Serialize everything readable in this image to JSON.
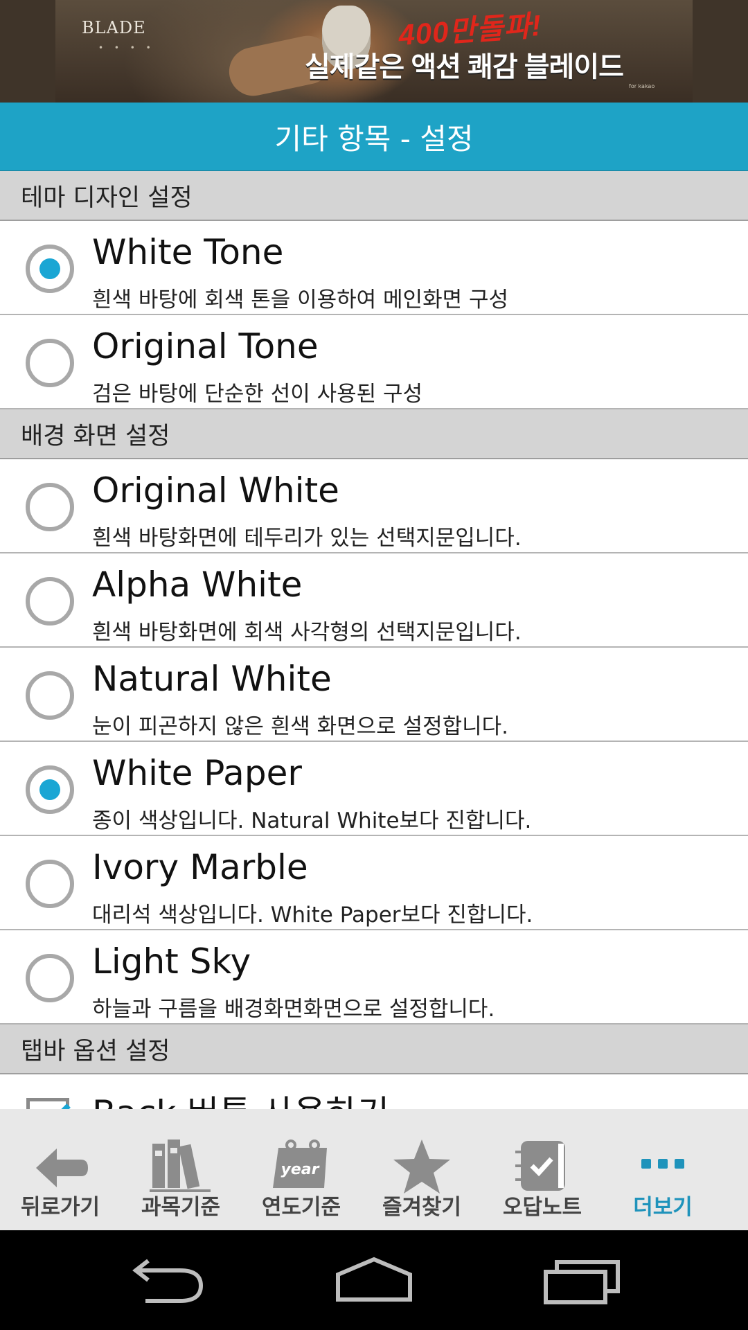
{
  "ad": {
    "logo": "BLADE",
    "logo_dots": "• • • •",
    "headline_red": "400만돌파!",
    "headline_white": "실제같은 액션 쾌감 블레이드",
    "publisher": "for kakao"
  },
  "header": {
    "title": "기타 항목 - 설정"
  },
  "sections": {
    "theme": {
      "label": "테마 디자인 설정",
      "items": [
        {
          "title": "White Tone",
          "subtitle": "흰색 바탕에 회색 톤을 이용하여 메인화면 구성",
          "checked": true
        },
        {
          "title": "Original Tone",
          "subtitle": "검은 바탕에 단순한 선이 사용된 구성",
          "checked": false
        }
      ]
    },
    "background": {
      "label": "배경 화면 설정",
      "items": [
        {
          "title": "Original White",
          "subtitle": "흰색 바탕화면에 테두리가 있는 선택지문입니다.",
          "checked": false
        },
        {
          "title": "Alpha White",
          "subtitle": "흰색 바탕화면에 회색 사각형의 선택지문입니다.",
          "checked": false
        },
        {
          "title": "Natural White",
          "subtitle": "눈이 피곤하지 않은 흰색 화면으로 설정합니다.",
          "checked": false
        },
        {
          "title": "White Paper",
          "subtitle": "종이 색상입니다. Natural White보다 진합니다.",
          "checked": true
        },
        {
          "title": "Ivory Marble",
          "subtitle": "대리석 색상입니다. White Paper보다 진합니다.",
          "checked": false
        },
        {
          "title": "Light Sky",
          "subtitle": "하늘과 구름을 배경화면화면으로 설정합니다.",
          "checked": false
        }
      ]
    },
    "tabbar_options": {
      "label": "탭바 옵션 설정",
      "items": [
        {
          "title": "Back 버튼 사용하기",
          "checked": true
        }
      ]
    }
  },
  "tabs": [
    {
      "label": "뒤로가기",
      "icon": "back-arrow-icon",
      "active": false
    },
    {
      "label": "과목기준",
      "icon": "books-icon",
      "active": false
    },
    {
      "label": "연도기준",
      "icon": "calendar-year-icon",
      "active": false,
      "icon_text": "year"
    },
    {
      "label": "즐겨찾기",
      "icon": "star-icon",
      "active": false
    },
    {
      "label": "오답노트",
      "icon": "note-check-icon",
      "active": false
    },
    {
      "label": "더보기",
      "icon": "more-dots-icon",
      "active": true
    }
  ],
  "navbar": {
    "buttons": [
      "back-nav-icon",
      "home-nav-icon",
      "recent-apps-nav-icon"
    ]
  },
  "colors": {
    "accent": "#1ea3c6",
    "radio_checked": "#1aa6d4",
    "active_tab": "#1f93bb"
  }
}
